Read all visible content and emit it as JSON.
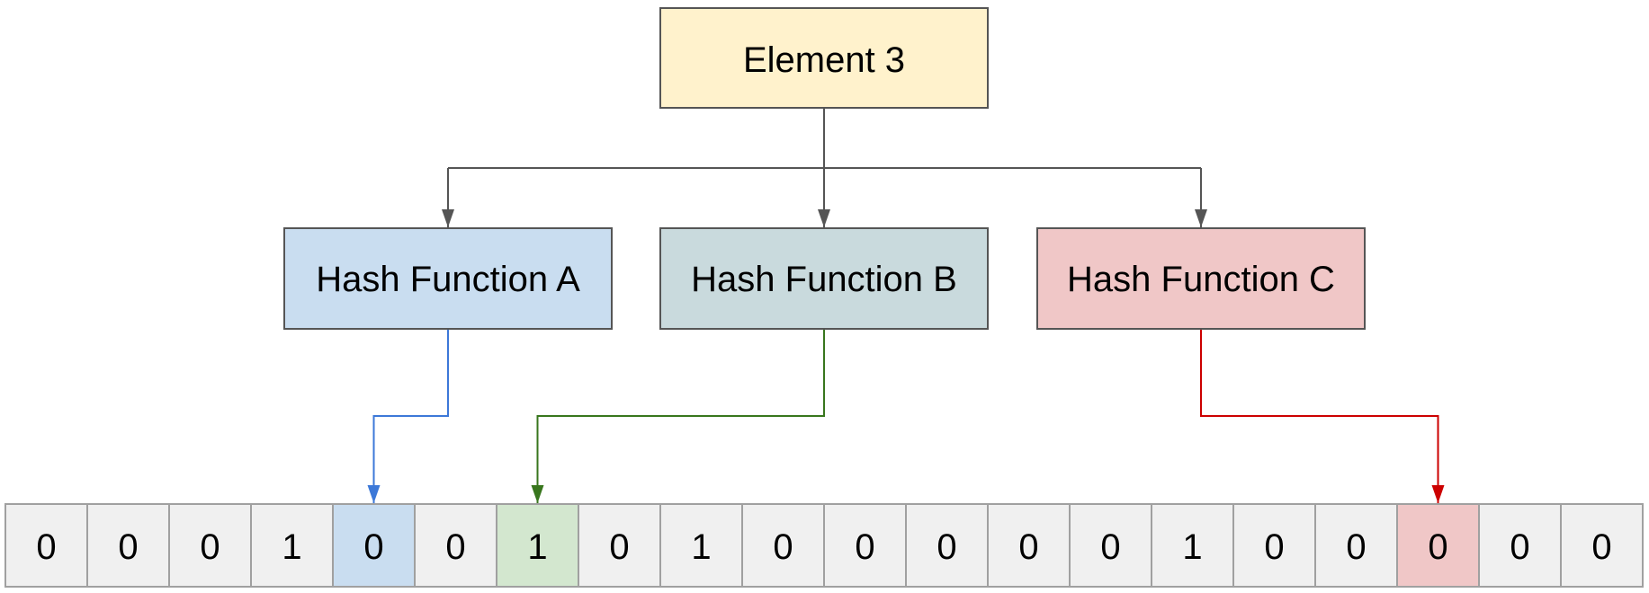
{
  "source": {
    "label": "Element 3",
    "fill": "#fff2cc"
  },
  "hash_functions": [
    {
      "label": "Hash Function A",
      "fill": "#c9ddf0",
      "arrow_color": "#3c78d8",
      "target_index": 4
    },
    {
      "label": "Hash Function B",
      "fill": "#c9dadd",
      "arrow_color": "#38761d",
      "target_index": 6
    },
    {
      "label": "Hash Function C",
      "fill": "#f0c7c7",
      "arrow_color": "#cc0000",
      "target_index": 17
    }
  ],
  "bit_array": {
    "values": [
      "0",
      "0",
      "0",
      "1",
      "0",
      "0",
      "1",
      "0",
      "1",
      "0",
      "0",
      "0",
      "0",
      "0",
      "1",
      "0",
      "0",
      "0",
      "0",
      "0"
    ],
    "default_fill": "#f0f0f0",
    "highlights": {
      "4": "#c9ddf0",
      "6": "#d3e7cf",
      "17": "#f0c7c7"
    }
  },
  "colors": {
    "connector": "#555555",
    "box_border": "#555555",
    "cell_border": "#a0a0a0"
  }
}
